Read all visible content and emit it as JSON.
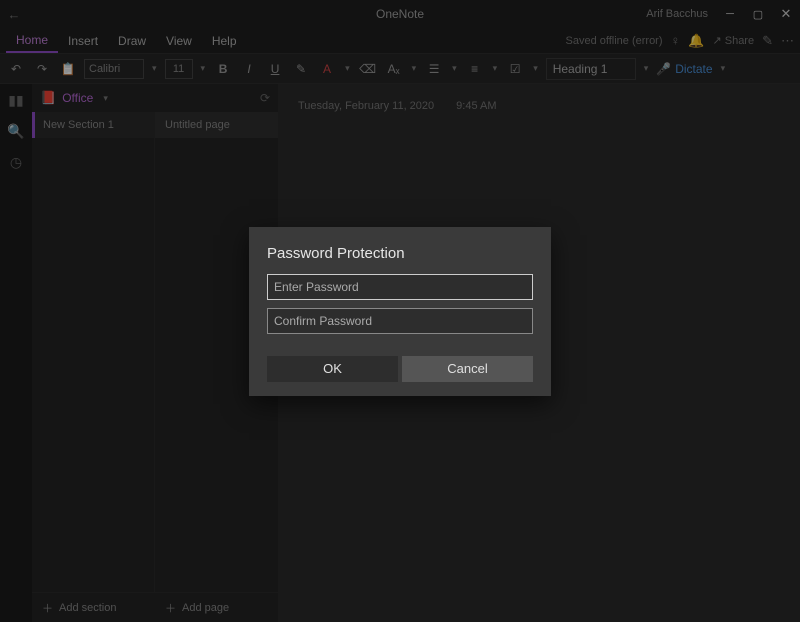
{
  "titlebar": {
    "app_title": "OneNote",
    "user_name": "Arif Bacchus"
  },
  "menu": {
    "tabs": [
      "Home",
      "Insert",
      "Draw",
      "View",
      "Help"
    ],
    "selected_index": 0,
    "status_text": "Saved offline (error)",
    "share_label": "Share"
  },
  "toolbar": {
    "font_name": "Calibri",
    "font_size": "11",
    "heading_label": "Heading 1",
    "dictate_label": "Dictate"
  },
  "notebook": {
    "name": "Office",
    "sections": [
      {
        "label": "New Section 1"
      }
    ],
    "pages": [
      {
        "label": "Untitled page"
      }
    ],
    "add_section_label": "Add section",
    "add_page_label": "Add page"
  },
  "editor": {
    "date": "Tuesday, February 11, 2020",
    "time": "9:45 AM"
  },
  "dialog": {
    "title": "Password Protection",
    "enter_placeholder": "Enter Password",
    "confirm_placeholder": "Confirm Password",
    "ok_label": "OK",
    "cancel_label": "Cancel"
  }
}
